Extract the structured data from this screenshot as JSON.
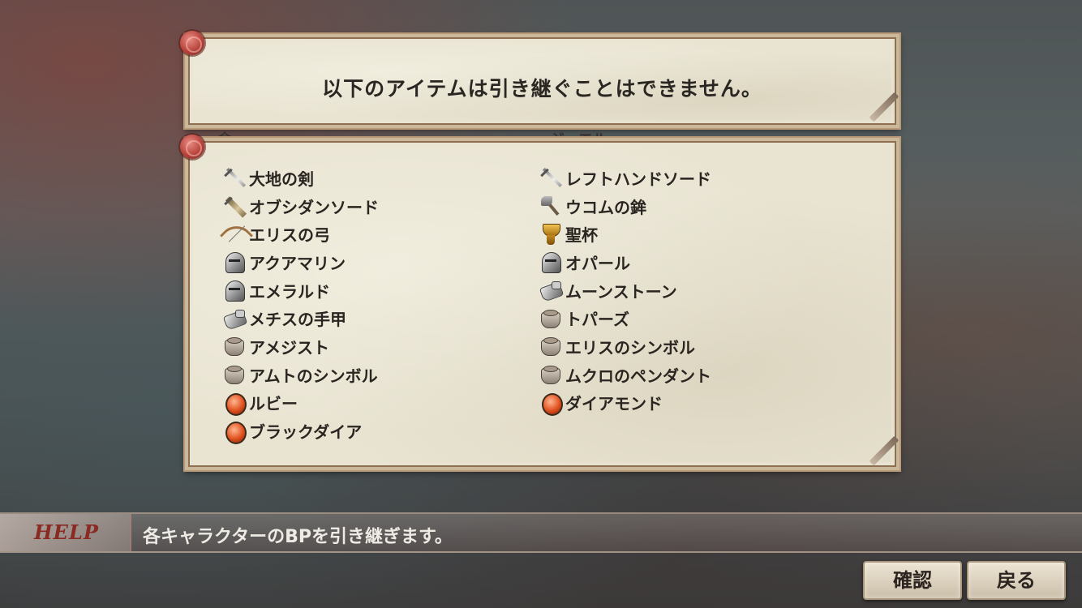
{
  "dialog": {
    "message": "以下のアイテムは引き継ぐことはできません。",
    "partially_hidden_labels": [
      "金",
      "ジュエル"
    ]
  },
  "items_left": [
    {
      "name": "大地の剣",
      "icon": "sword-icon"
    },
    {
      "name": "オブシダンソード",
      "icon": "greatsword-icon"
    },
    {
      "name": "エリスの弓",
      "icon": "bow-icon"
    },
    {
      "name": "アクアマリン",
      "icon": "helmet-icon"
    },
    {
      "name": "エメラルド",
      "icon": "helmet-icon"
    },
    {
      "name": "メチスの手甲",
      "icon": "gauntlet-icon"
    },
    {
      "name": "アメジスト",
      "icon": "ring-icon"
    },
    {
      "name": "アムトのシンボル",
      "icon": "ring-icon"
    },
    {
      "name": "ルビー",
      "icon": "gem-icon"
    },
    {
      "name": "ブラックダイア",
      "icon": "gem-icon"
    }
  ],
  "items_right": [
    {
      "name": "レフトハンドソード",
      "icon": "sword-icon"
    },
    {
      "name": "ウコムの鉾",
      "icon": "axe-icon"
    },
    {
      "name": "聖杯",
      "icon": "chalice-icon"
    },
    {
      "name": "オパール",
      "icon": "helmet-icon"
    },
    {
      "name": "ムーンストーン",
      "icon": "gauntlet-icon"
    },
    {
      "name": "トパーズ",
      "icon": "ring-icon"
    },
    {
      "name": "エリスのシンボル",
      "icon": "ring-icon"
    },
    {
      "name": "ムクロのペンダント",
      "icon": "ring-icon"
    },
    {
      "name": "ダイアモンド",
      "icon": "gem-icon"
    }
  ],
  "help": {
    "label": "HELP",
    "text": "各キャラクターのBPを引き継ぎます。"
  },
  "buttons": {
    "confirm": "確認",
    "back": "戻る"
  }
}
